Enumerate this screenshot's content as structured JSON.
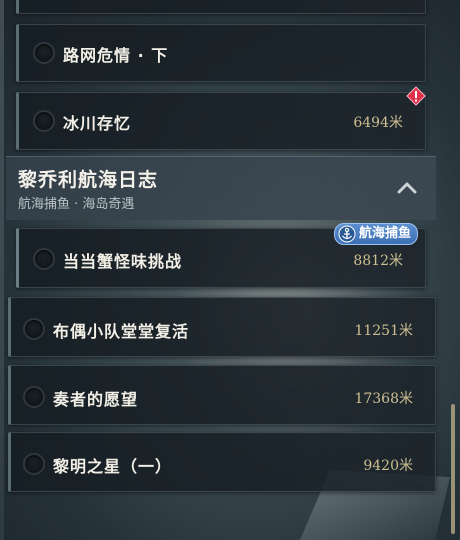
{
  "quest_list": [
    {
      "title": "",
      "distance": ""
    },
    {
      "title": "路网危情 · 下",
      "distance": ""
    },
    {
      "title": "冰川存忆",
      "distance": "6494米",
      "alert": true
    }
  ],
  "group": {
    "title": "黎乔利航海日志",
    "subtitle": "航海捕鱼 · 海岛奇遇",
    "badge_label": "航海捕鱼",
    "collapse_icon": "chevron-up-icon",
    "quests": [
      {
        "title": "当当蟹怪味挑战",
        "distance": "8812米"
      }
    ]
  },
  "other_quests": [
    {
      "title": "布偶小队堂堂复活",
      "distance": "11251米"
    },
    {
      "title": "奏者的愿望",
      "distance": "17368米"
    },
    {
      "title": "黎明之星（一）",
      "distance": "9420米"
    }
  ],
  "colors": {
    "distance": "#cdbf92",
    "title": "#f2efe6",
    "badge": "#4a7fc2",
    "alert": "#e0314a"
  }
}
